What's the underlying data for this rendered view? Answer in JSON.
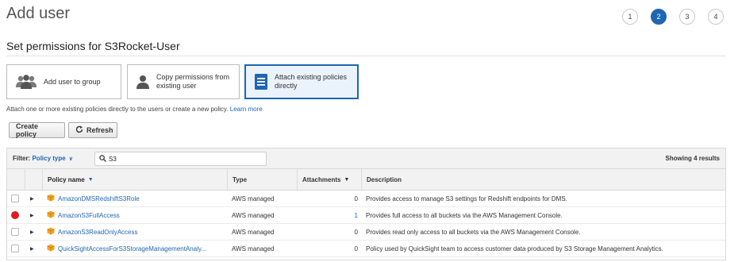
{
  "header": {
    "title": "Add user",
    "steps": [
      "1",
      "2",
      "3",
      "4"
    ],
    "active_step": "2"
  },
  "section": {
    "title": "Set permissions for S3Rocket-User"
  },
  "options": {
    "group": {
      "label": "Add user to group",
      "icon": "users-group-icon"
    },
    "copy": {
      "label_line1": "Copy permissions from",
      "label_line2": "existing user",
      "icon": "user-icon"
    },
    "attach": {
      "label_line1": "Attach existing policies",
      "label_line2": "directly",
      "icon": "document-icon"
    }
  },
  "help": {
    "text": "Attach one or more existing policies directly to the users or create a new policy.",
    "link": "Learn more"
  },
  "toolbar": {
    "create_label": "Create policy",
    "refresh_label": "Refresh"
  },
  "filter": {
    "label": "Filter:",
    "value": "Policy type",
    "search_value": "S3",
    "result_count": "Showing 4 results"
  },
  "table": {
    "columns": {
      "name": "Policy name",
      "type": "Type",
      "attachments": "Attachments",
      "description": "Description"
    },
    "rows": [
      {
        "name": "AmazonDMSRedshiftS3Role",
        "type": "AWS managed",
        "attachments": "0",
        "description": "Provides access to manage S3 settings for Redshift endpoints for DMS."
      },
      {
        "name": "AmazonS3FullAccess",
        "type": "AWS managed",
        "attachments": "1",
        "description": "Provides full access to all buckets via the AWS Management Console."
      },
      {
        "name": "AmazonS3ReadOnlyAccess",
        "type": "AWS managed",
        "attachments": "0",
        "description": "Provides read only access to all buckets via the AWS Management Console."
      },
      {
        "name": "QuickSightAccessForS3StorageManagementAnaly...",
        "type": "AWS managed",
        "attachments": "0",
        "description": "Policy used by QuickSight team to access customer data produced by S3 Storage Management Analytics."
      }
    ]
  },
  "colors": {
    "accent": "#1f66b2",
    "selected_bg": "#eaf3fc",
    "marked": "#e0191f",
    "policy_icon": "#f5a623"
  }
}
